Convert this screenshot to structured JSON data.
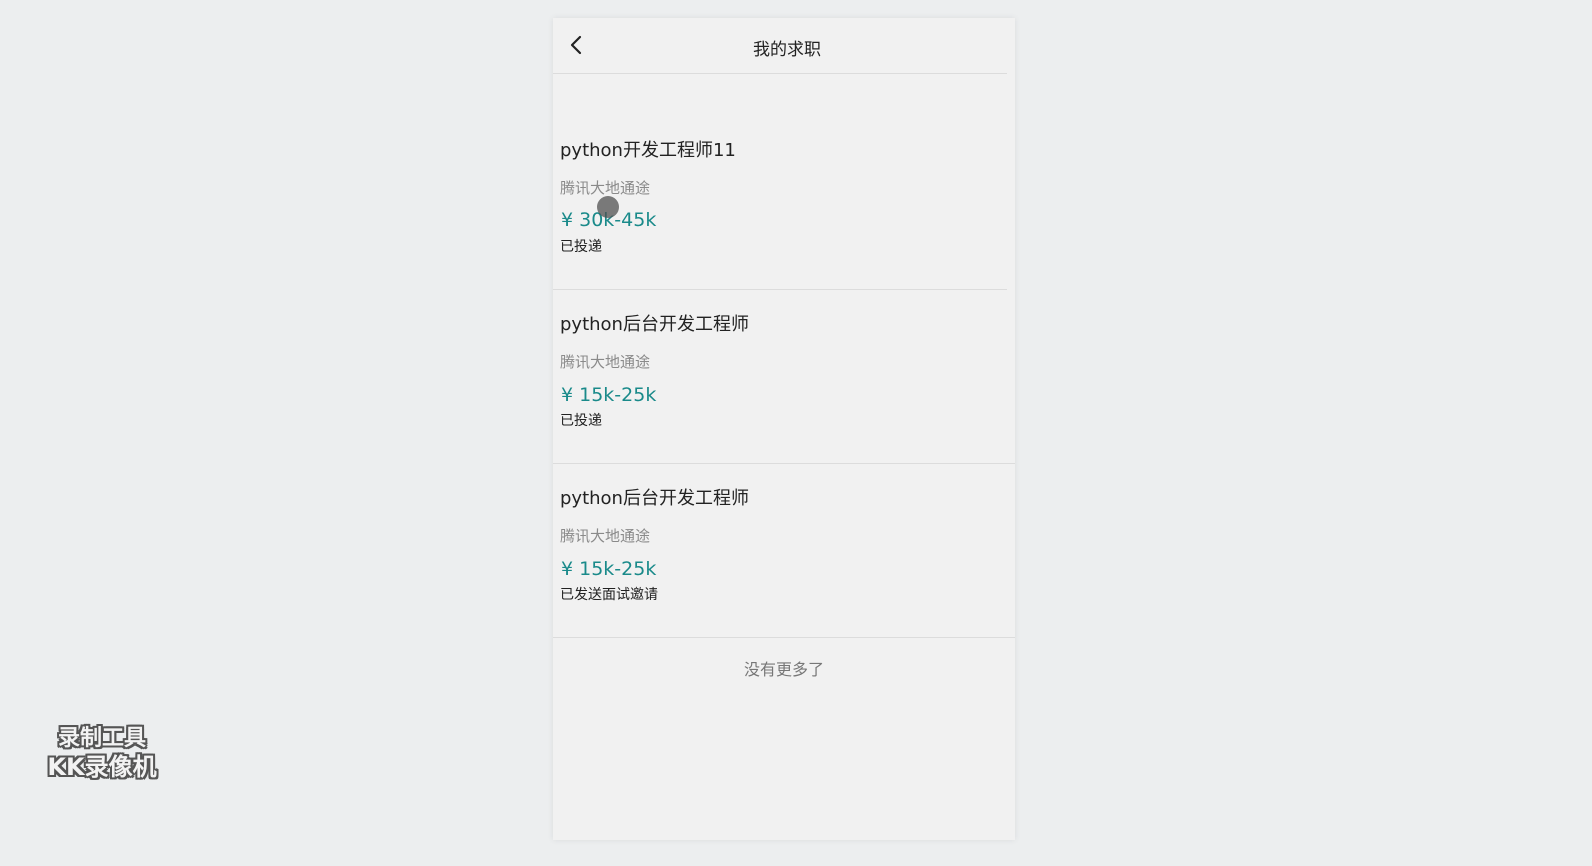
{
  "header": {
    "title": "我的求职"
  },
  "jobs": [
    {
      "title": "python开发工程师11",
      "company": "腾讯大地通途",
      "salary": "¥ 30k-45k",
      "status": "已投递"
    },
    {
      "title": "python后台开发工程师",
      "company": "腾讯大地通途",
      "salary": "¥ 15k-25k",
      "status": "已投递"
    },
    {
      "title": "python后台开发工程师",
      "company": "腾讯大地通途",
      "salary": "¥ 15k-25k",
      "status": "已发送面试邀请"
    }
  ],
  "footer": {
    "no_more": "没有更多了"
  },
  "watermark": {
    "line1": "录制工具",
    "line2": "KK录像机"
  },
  "colors": {
    "salary": "#1a8a8a",
    "background": "#eceeef",
    "panel": "#f1f1f1"
  }
}
